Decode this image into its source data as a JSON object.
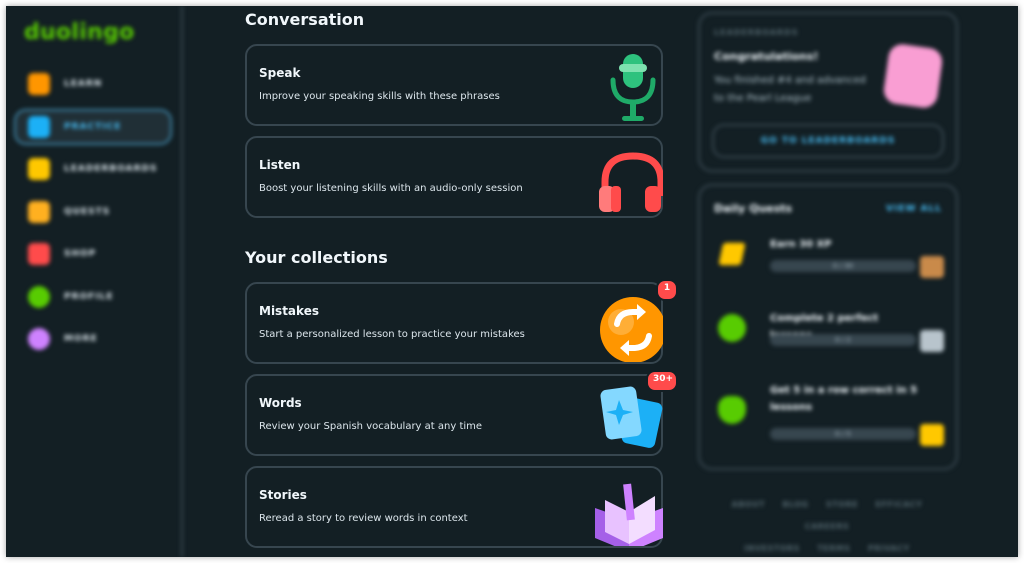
{
  "app": {
    "logo": "duolingo"
  },
  "sidebar": {
    "items": [
      {
        "label": "LEARN",
        "icon": "home-icon",
        "color": "#ff9600"
      },
      {
        "label": "PRACTICE",
        "icon": "dumbbell-icon",
        "color": "#1cb0f6",
        "active": true
      },
      {
        "label": "LEADERBOARDS",
        "icon": "shield-icon",
        "color": "#ffc800"
      },
      {
        "label": "QUESTS",
        "icon": "chest-icon",
        "color": "#ffb020"
      },
      {
        "label": "SHOP",
        "icon": "shop-icon",
        "color": "#ff4b4b"
      },
      {
        "label": "PROFILE",
        "icon": "avatar-icon",
        "color": "#58cc02"
      },
      {
        "label": "MORE",
        "icon": "more-icon",
        "color": "#ce82ff"
      }
    ]
  },
  "conversation": {
    "title": "Conversation",
    "cards": [
      {
        "title": "Speak",
        "subtitle": "Improve your speaking skills with these phrases",
        "icon": "microphone-icon"
      },
      {
        "title": "Listen",
        "subtitle": "Boost your listening skills with an audio-only session",
        "icon": "headphones-icon"
      }
    ]
  },
  "collections": {
    "title": "Your collections",
    "cards": [
      {
        "title": "Mistakes",
        "subtitle": "Start a personalized lesson to practice your mistakes",
        "badge": "1",
        "icon": "refresh-icon"
      },
      {
        "title": "Words",
        "subtitle": "Review your Spanish vocabulary at any time",
        "badge": "30+",
        "icon": "flashcards-icon"
      },
      {
        "title": "Stories",
        "subtitle": "Reread a story to review words in context",
        "icon": "book-icon"
      }
    ]
  },
  "leaderboard": {
    "kicker": "LEADERBOARDS",
    "title": "Congratulations!",
    "text": "You finished #4 and advanced to the Pearl League",
    "button": "GO TO LEADERBOARDS"
  },
  "quests": {
    "title": "Daily Quests",
    "view_all": "VIEW ALL",
    "items": [
      {
        "label": "Earn 30 XP",
        "progress_text": "0 / 30",
        "progress": 0,
        "icon": "lightning-icon"
      },
      {
        "label": "Complete 2 perfect lessons",
        "progress_text": "0 / 2",
        "progress": 0,
        "icon": "target-icon"
      },
      {
        "label": "Get 5 in a row correct in 5 lessons",
        "progress_text": "0 / 5",
        "progress": 0,
        "icon": "owl-icon"
      }
    ]
  },
  "footer": {
    "links": [
      "ABOUT",
      "BLOG",
      "STORE",
      "EFFICACY",
      "CAREERS",
      "INVESTORS",
      "TERMS",
      "PRIVACY"
    ]
  },
  "colors": {
    "background": "#131f24",
    "border": "#37464f",
    "accent_blue": "#49c0f8",
    "badge_red": "#ff4b4b",
    "brand_green": "#58cc02"
  }
}
